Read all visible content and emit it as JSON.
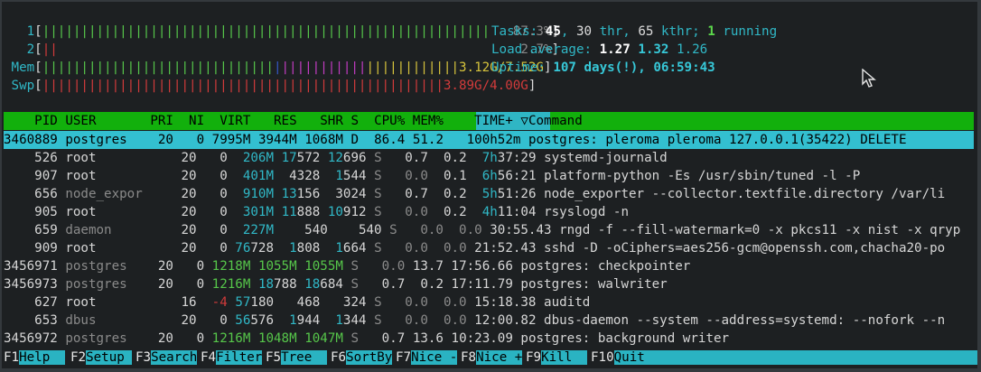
{
  "meters": {
    "cpu1": {
      "label": "1",
      "bar": "||||||||||||||||||||||||||||||||||||||||||||||||||||||||||",
      "value": "87.3%"
    },
    "cpu2": {
      "label": "2",
      "bar": "||",
      "value": "2.7%"
    },
    "mem": {
      "label": "Mem",
      "bar_green": "||||||||||||||||||||||||||||||",
      "bar_blue": "|",
      "bar_magenta": "|||||||||||",
      "bar_yellow": "||||||||||||",
      "value": "3.12G/7.52G"
    },
    "swp": {
      "label": "Swp",
      "bar": "||||||||||||||||||||||||||||||||||||||||||||||||||||",
      "value": "3.89G/4.00G"
    }
  },
  "summary": {
    "tasks_label": "Tasks:",
    "tasks": "45",
    "thr": "30",
    "thr_label": "thr,",
    "kthr": "65",
    "kthr_label": "kthr;",
    "running": "1",
    "running_label": "running",
    "load_label": "Load average:",
    "load1": "1.27",
    "load5": "1.32",
    "load15": "1.26",
    "uptime_label": "Uptime:",
    "uptime": "107 days(!), 06:59:43"
  },
  "columns": {
    "pid": "PID",
    "user": "USER",
    "pri": "PRI",
    "ni": "NI",
    "virt": "VIRT",
    "res": "RES",
    "shr": "SHR",
    "s": "S",
    "cpu": "CPU%",
    "mem": "MEM%",
    "time": "TIME+",
    "sort_icon": "▽",
    "command": "Command"
  },
  "processes": [
    {
      "pid": "3460889",
      "user": "postgres",
      "pri": "20",
      "ni": "0",
      "virt": "7995M",
      "res": "3944M",
      "shr": "1068M",
      "s": "D",
      "cpu": "86.4",
      "mem": "51.2",
      "time": "100h52m",
      "command": "postgres: pleroma pleroma 127.0.0.1(35422) DELETE"
    },
    {
      "pid": "526",
      "user": "root",
      "pri": "20",
      "ni": "0",
      "virt": "206M",
      "res": "17572",
      "shr": "12696",
      "s": "S",
      "cpu": "0.7",
      "mem": "0.2",
      "time": "7h37:29",
      "command": "systemd-journald"
    },
    {
      "pid": "907",
      "user": "root",
      "pri": "20",
      "ni": "0",
      "virt": "401M",
      "res": "4328",
      "shr": "1544",
      "s": "S",
      "cpu": "0.0",
      "mem": "0.1",
      "time": "6h56:21",
      "command": "platform-python -Es /usr/sbin/tuned -l -P"
    },
    {
      "pid": "656",
      "user": "node_expor",
      "pri": "20",
      "ni": "0",
      "virt": "910M",
      "res": "13156",
      "shr": "3024",
      "s": "S",
      "cpu": "0.7",
      "mem": "0.2",
      "time": "5h51:26",
      "command": "node_exporter --collector.textfile.directory /var/li"
    },
    {
      "pid": "905",
      "user": "root",
      "pri": "20",
      "ni": "0",
      "virt": "301M",
      "res": "11888",
      "shr": "10912",
      "s": "S",
      "cpu": "0.0",
      "mem": "0.2",
      "time": "4h11:04",
      "command": "rsyslogd -n"
    },
    {
      "pid": "659",
      "user": "daemon",
      "pri": "20",
      "ni": "0",
      "virt": "227M",
      "res": "540",
      "shr": "540",
      "s": "S",
      "cpu": "0.0",
      "mem": "0.0",
      "time": "30:55.43",
      "command": "rngd -f --fill-watermark=0 -x pkcs11 -x nist -x qryp"
    },
    {
      "pid": "909",
      "user": "root",
      "pri": "20",
      "ni": "0",
      "virt": "76728",
      "res": "1808",
      "shr": "1664",
      "s": "S",
      "cpu": "0.0",
      "mem": "0.0",
      "time": "21:52.43",
      "command": "sshd -D -oCiphers=aes256-gcm@openssh.com,chacha20-po"
    },
    {
      "pid": "3456971",
      "user": "postgres",
      "pri": "20",
      "ni": "0",
      "virt": "1218M",
      "res": "1055M",
      "shr": "1055M",
      "s": "S",
      "cpu": "0.0",
      "mem": "13.7",
      "time": "17:56.66",
      "command": "postgres: checkpointer"
    },
    {
      "pid": "3456973",
      "user": "postgres",
      "pri": "20",
      "ni": "0",
      "virt": "1216M",
      "res": "18788",
      "shr": "18684",
      "s": "S",
      "cpu": "0.7",
      "mem": "0.2",
      "time": "17:11.79",
      "command": "postgres: walwriter"
    },
    {
      "pid": "627",
      "user": "root",
      "pri": "16",
      "ni": "-4",
      "virt": "57180",
      "res": "468",
      "shr": "324",
      "s": "S",
      "cpu": "0.0",
      "mem": "0.0",
      "time": "15:18.38",
      "command": "auditd"
    },
    {
      "pid": "653",
      "user": "dbus",
      "pri": "20",
      "ni": "0",
      "virt": "56576",
      "res": "1944",
      "shr": "1344",
      "s": "S",
      "cpu": "0.0",
      "mem": "0.0",
      "time": "12:00.82",
      "command": "dbus-daemon --system --address=systemd: --nofork --n"
    },
    {
      "pid": "3456972",
      "user": "postgres",
      "pri": "20",
      "ni": "0",
      "virt": "1216M",
      "res": "1048M",
      "shr": "1047M",
      "s": "S",
      "cpu": "0.7",
      "mem": "13.6",
      "time": "10:23.09",
      "command": "postgres: background writer"
    }
  ],
  "footer": [
    {
      "key": "F1",
      "label": "Help  "
    },
    {
      "key": "F2",
      "label": "Setup "
    },
    {
      "key": "F3",
      "label": "Search"
    },
    {
      "key": "F4",
      "label": "Filter"
    },
    {
      "key": "F5",
      "label": "Tree  "
    },
    {
      "key": "F6",
      "label": "SortBy"
    },
    {
      "key": "F7",
      "label": "Nice -"
    },
    {
      "key": "F8",
      "label": "Nice +"
    },
    {
      "key": "F9",
      "label": "Kill  "
    },
    {
      "key": "F10",
      "label": "Quit"
    }
  ],
  "colors": {
    "accent_cyan": "#30b8c7",
    "header_green": "#12b00c",
    "selected_row": "#33bfd0"
  }
}
